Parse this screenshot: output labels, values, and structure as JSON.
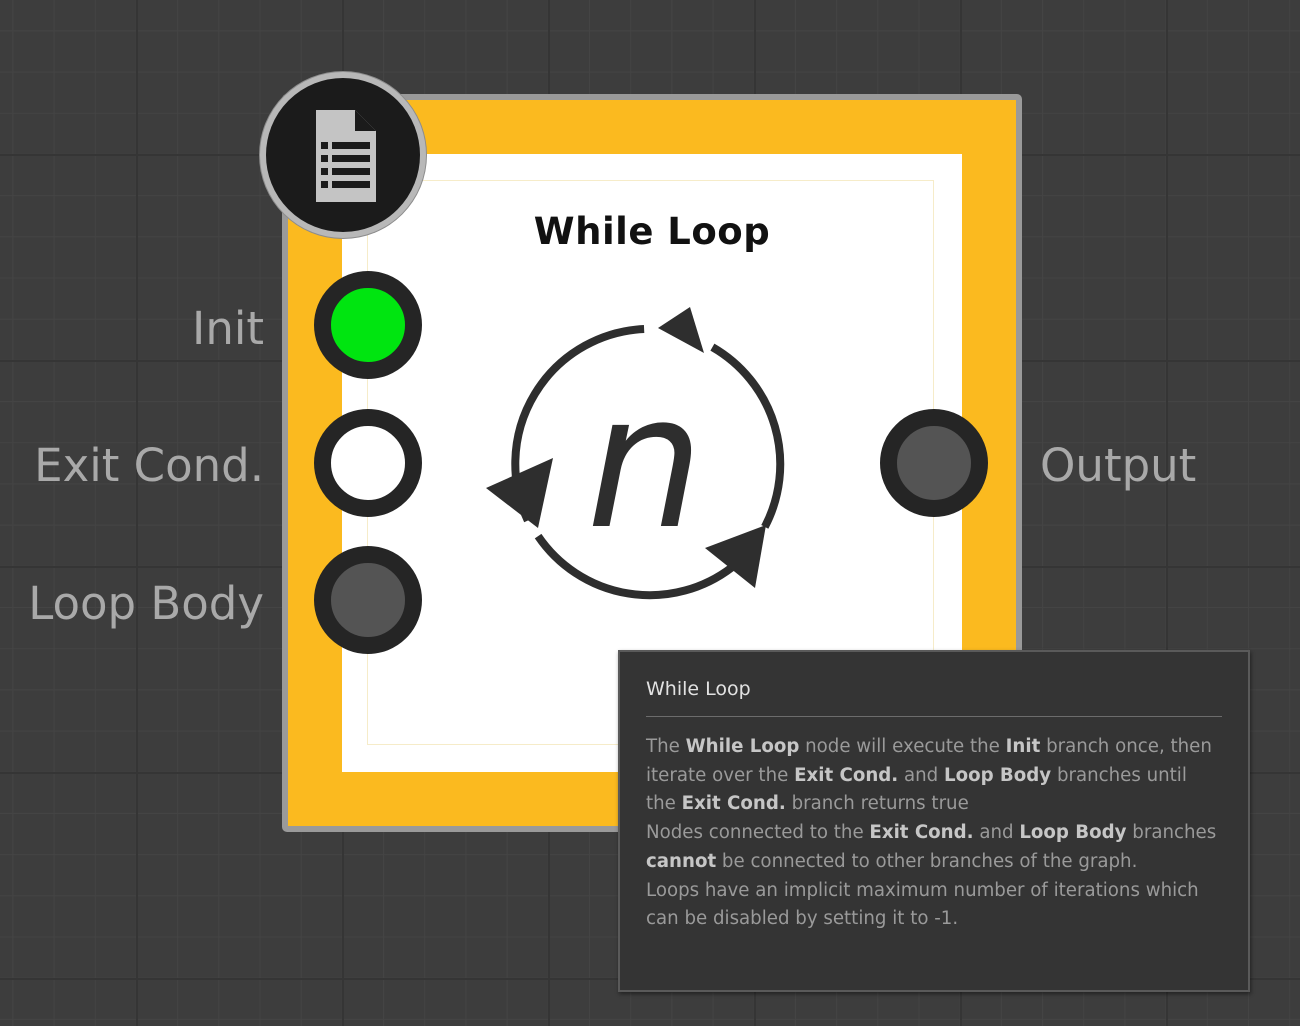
{
  "node": {
    "title": "While Loop",
    "badge_icon": "document-list-icon",
    "center_icon": "loop-n-icon",
    "center_glyph": "n",
    "frame_color": "#fbba1f",
    "inputs": [
      {
        "label": "Init",
        "color": "#00e510"
      },
      {
        "label": "Exit Cond.",
        "color": "#ffffff"
      },
      {
        "label": "Loop Body",
        "color": "#545454"
      }
    ],
    "outputs": [
      {
        "label": "Output",
        "color": "#545454"
      }
    ]
  },
  "tooltip": {
    "title": "While Loop",
    "p1": {
      "t1": "The ",
      "b1": "While Loop",
      "t2": " node will execute the ",
      "b2": "Init",
      "t3": " branch once, then iterate over the ",
      "b3": "Exit Cond.",
      "t4": " and ",
      "b4": "Loop Body",
      "t5": " branches until the ",
      "b5": "Exit Cond.",
      "t6": " branch returns true"
    },
    "p2": {
      "t1": "Nodes connected to the ",
      "b1": "Exit Cond.",
      "t2": " and ",
      "b2": "Loop Body",
      "t3": " branches ",
      "b3": "cannot",
      "t4": " be connected to other branches of the graph."
    },
    "p3": "Loops have an implicit maximum number of iterations which can be disabled by setting it to -1."
  }
}
